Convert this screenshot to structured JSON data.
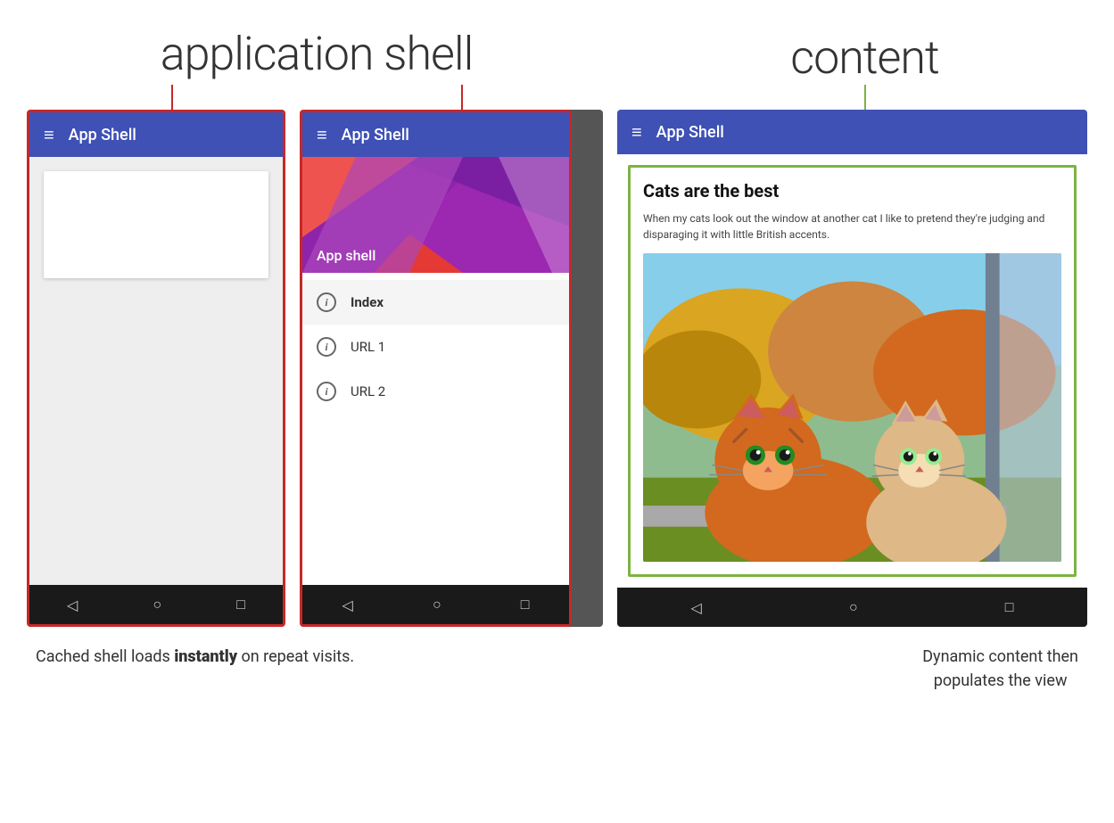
{
  "page": {
    "title_app_shell": "application shell",
    "title_content": "content"
  },
  "phone1": {
    "toolbar_title": "App Shell",
    "hamburger": "≡"
  },
  "phone2": {
    "toolbar_title": "App Shell",
    "hamburger": "≡",
    "drawer_header": "App shell",
    "menu_items": [
      {
        "label": "Index",
        "bold": true
      },
      {
        "label": "URL 1",
        "bold": false
      },
      {
        "label": "URL 2",
        "bold": false
      }
    ]
  },
  "phone3": {
    "toolbar_title": "App Shell",
    "hamburger": "≡",
    "content": {
      "title": "Cats are the best",
      "description": "When my cats look out the window at another cat I like to pretend they're judging and disparaging it with little British accents."
    }
  },
  "captions": {
    "left": "Cached shell loads instantly on repeat visits.",
    "left_bold": "instantly",
    "right_line1": "Dynamic content then",
    "right_line2": "populates the view"
  },
  "nav_icons": {
    "back": "◁",
    "home": "○",
    "recent": "□"
  },
  "colors": {
    "toolbar_blue": "#3f51b5",
    "outline_red": "#c62828",
    "outline_green": "#7cb342",
    "nav_bar": "#1a1a1a"
  }
}
